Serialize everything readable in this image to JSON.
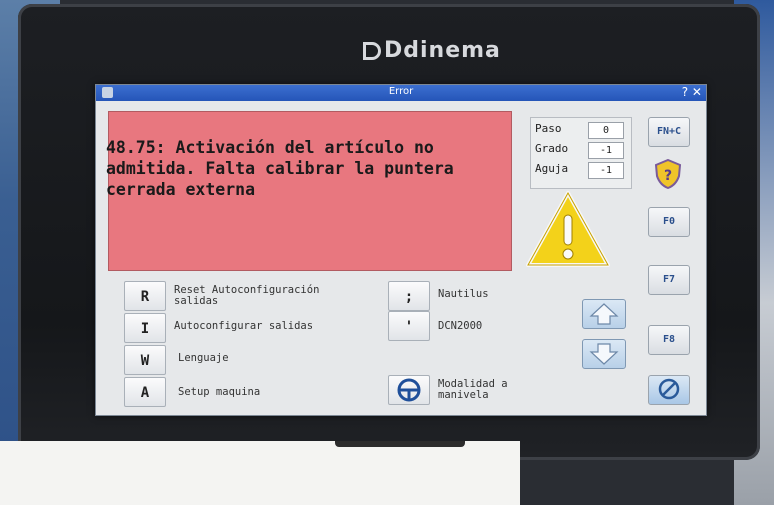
{
  "brand": "Ddinema",
  "window": {
    "title": "Error",
    "controls": "? ✕"
  },
  "error": {
    "message": "48.75: Activación del artículo no admitida. Falta calibrar la puntera cerrada externa"
  },
  "info": [
    {
      "label": "Paso",
      "value": "0"
    },
    {
      "label": "Grado",
      "value": "-1"
    },
    {
      "label": "Aguja",
      "value": "-1"
    }
  ],
  "right_buttons": {
    "fnc": "FN+C",
    "f0": "F0",
    "f7": "F7",
    "f8": "F8"
  },
  "commands_left": [
    {
      "key": "R",
      "label": "Reset Autoconfiguración salidas"
    },
    {
      "key": "I",
      "label": "Autoconfigurar salidas"
    },
    {
      "key": "W",
      "label": "Lenguaje"
    },
    {
      "key": "A",
      "label": "Setup maquina"
    }
  ],
  "commands_mid": [
    {
      "key": ";",
      "label": "Nautilus"
    },
    {
      "key": "'",
      "label": "DCN2000"
    },
    {
      "key": "",
      "label": "Modalidad a manivela"
    }
  ],
  "icons": {
    "warning": "warning-triangle-icon",
    "help": "help-shield-icon",
    "up": "arrow-up-icon",
    "down": "arrow-down-icon",
    "steering": "steering-wheel-icon",
    "cancel": "no-entry-icon"
  },
  "colors": {
    "error_bg": "#e8777f",
    "titlebar": "#2f62c4",
    "warning_fill": "#f3d21a"
  }
}
